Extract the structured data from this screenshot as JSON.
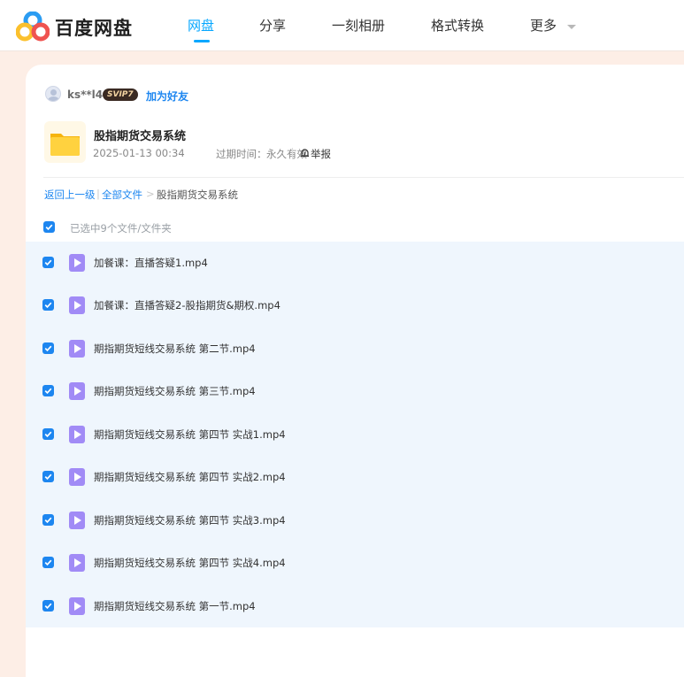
{
  "header": {
    "logo_text": "百度网盘",
    "nav": [
      {
        "label": "网盘",
        "active": true
      },
      {
        "label": "分享",
        "active": false
      },
      {
        "label": "一刻相册",
        "active": false
      },
      {
        "label": "格式转换",
        "active": false
      },
      {
        "label": "更多",
        "active": false
      }
    ]
  },
  "user": {
    "name": "ks**l4",
    "badge": "SVIP7",
    "add_friend": "加为好友"
  },
  "share": {
    "title": "股指期货交易系统",
    "date": "2025-01-13 00:34",
    "expire_label": "过期时间：",
    "expire_value": "永久有效",
    "report": "举报"
  },
  "breadcrumb": {
    "back": "返回上一级",
    "sep1": "|",
    "all_files": "全部文件",
    "sep2": ">",
    "current": "股指期货交易系统"
  },
  "selection": {
    "label": "已选中9个文件/文件夹"
  },
  "files": [
    {
      "name": "加餐课：直播答疑1.mp4",
      "checked": true
    },
    {
      "name": "加餐课：直播答疑2-股指期货&期权.mp4",
      "checked": true
    },
    {
      "name": "期指期货短线交易系统 第二节.mp4",
      "checked": true
    },
    {
      "name": "期指期货短线交易系统 第三节.mp4",
      "checked": true
    },
    {
      "name": "期指期货短线交易系统 第四节 实战1.mp4",
      "checked": true
    },
    {
      "name": "期指期货短线交易系统 第四节 实战2.mp4",
      "checked": true
    },
    {
      "name": "期指期货短线交易系统 第四节 实战3.mp4",
      "checked": true
    },
    {
      "name": "期指期货短线交易系统 第四节 实战4.mp4",
      "checked": true
    },
    {
      "name": "期指期货短线交易系统 第一节.mp4",
      "checked": true
    }
  ],
  "colors": {
    "accent": "#06a7ff",
    "link": "#1d86f0",
    "page_bg": "#fdeee6",
    "list_bg": "#eff6fd",
    "video_icon": "#a18bf6"
  }
}
